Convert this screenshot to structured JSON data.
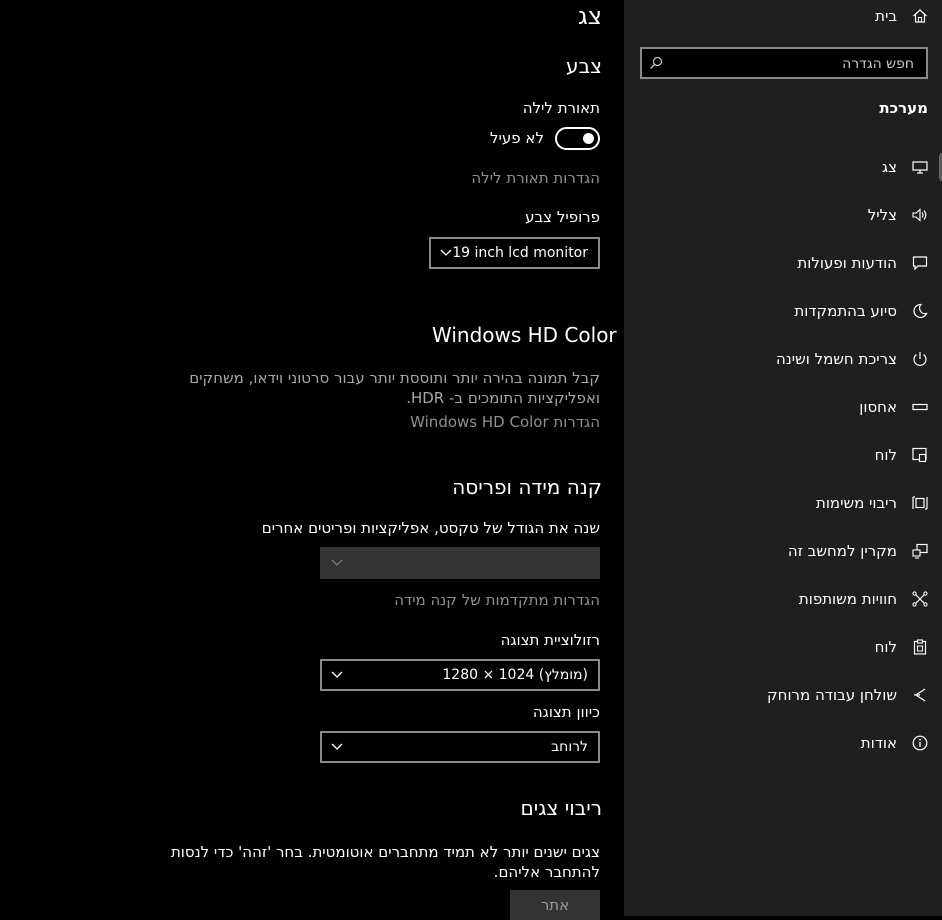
{
  "main": {
    "page_title": "צג",
    "color_section": {
      "heading": "צבע",
      "night_light_label": "תאורת לילה",
      "night_light_state": "לא פעיל",
      "night_light_settings_link": "הגדרות תאורת לילה",
      "color_profile_label": "פרופיל צבע",
      "color_profile_value": "19 inch lcd monitor"
    },
    "hd_color_section": {
      "heading": "Windows HD Color",
      "description_line1": "קבל תמונה בהירה יותר ותוססת יותר עבור סרטוני וידאו, משחקים",
      "description_line2": "ואפליקציות התומכים ב- HDR.",
      "settings_link": "הגדרות Windows HD Color"
    },
    "scale_section": {
      "heading": "קנה מידה ופריסה",
      "scale_label": "שנה את הגודל של טקסט, אפליקציות ופריטים אחרים",
      "scale_value": "",
      "advanced_link": "הגדרות מתקדמות של קנה מידה",
      "resolution_label": "רזולוציית תצוגה",
      "resolution_value": "1280 × 1024 (מומלץ)",
      "orientation_label": "כיוון תצוגה",
      "orientation_value": "לרוחב"
    },
    "multiple_displays": {
      "heading": "ריבוי צגים",
      "description_line1": "צגים ישנים יותר לא תמיד מתחברים אוטומטית. בחר 'זהה' כדי לנסות",
      "description_line2": "להתחבר אליהם.",
      "detect_button": "אתר"
    }
  },
  "sidebar": {
    "home_label": "בית",
    "search_placeholder": "חפש הגדרה",
    "section_title": "מערכת",
    "items": [
      {
        "label": "צג",
        "icon": "monitor-icon"
      },
      {
        "label": "צליל",
        "icon": "speaker-icon"
      },
      {
        "label": "הודעות ופעולות",
        "icon": "notification-icon"
      },
      {
        "label": "סיוע בהתמקדות",
        "icon": "moon-icon"
      },
      {
        "label": "צריכת חשמל ושינה",
        "icon": "power-icon"
      },
      {
        "label": "אחסון",
        "icon": "storage-icon"
      },
      {
        "label": "לוח",
        "icon": "tablet-icon"
      },
      {
        "label": "ריבוי משימות",
        "icon": "multitasking-icon"
      },
      {
        "label": "מקרין למחשב זה",
        "icon": "projecting-icon"
      },
      {
        "label": "חוויות משותפות",
        "icon": "shared-experiences-icon"
      },
      {
        "label": "לוח",
        "icon": "clipboard-icon"
      },
      {
        "label": "שולחן עבודה מרוחק",
        "icon": "remote-desktop-icon"
      },
      {
        "label": "אודות",
        "icon": "info-icon"
      }
    ]
  },
  "colors": {
    "sidebar_bg": "#1f1f1f",
    "main_bg": "#000000",
    "link_gray": "#8f8f8f",
    "disabled_combo": "#333333",
    "detect_button_bg": "#333333"
  }
}
